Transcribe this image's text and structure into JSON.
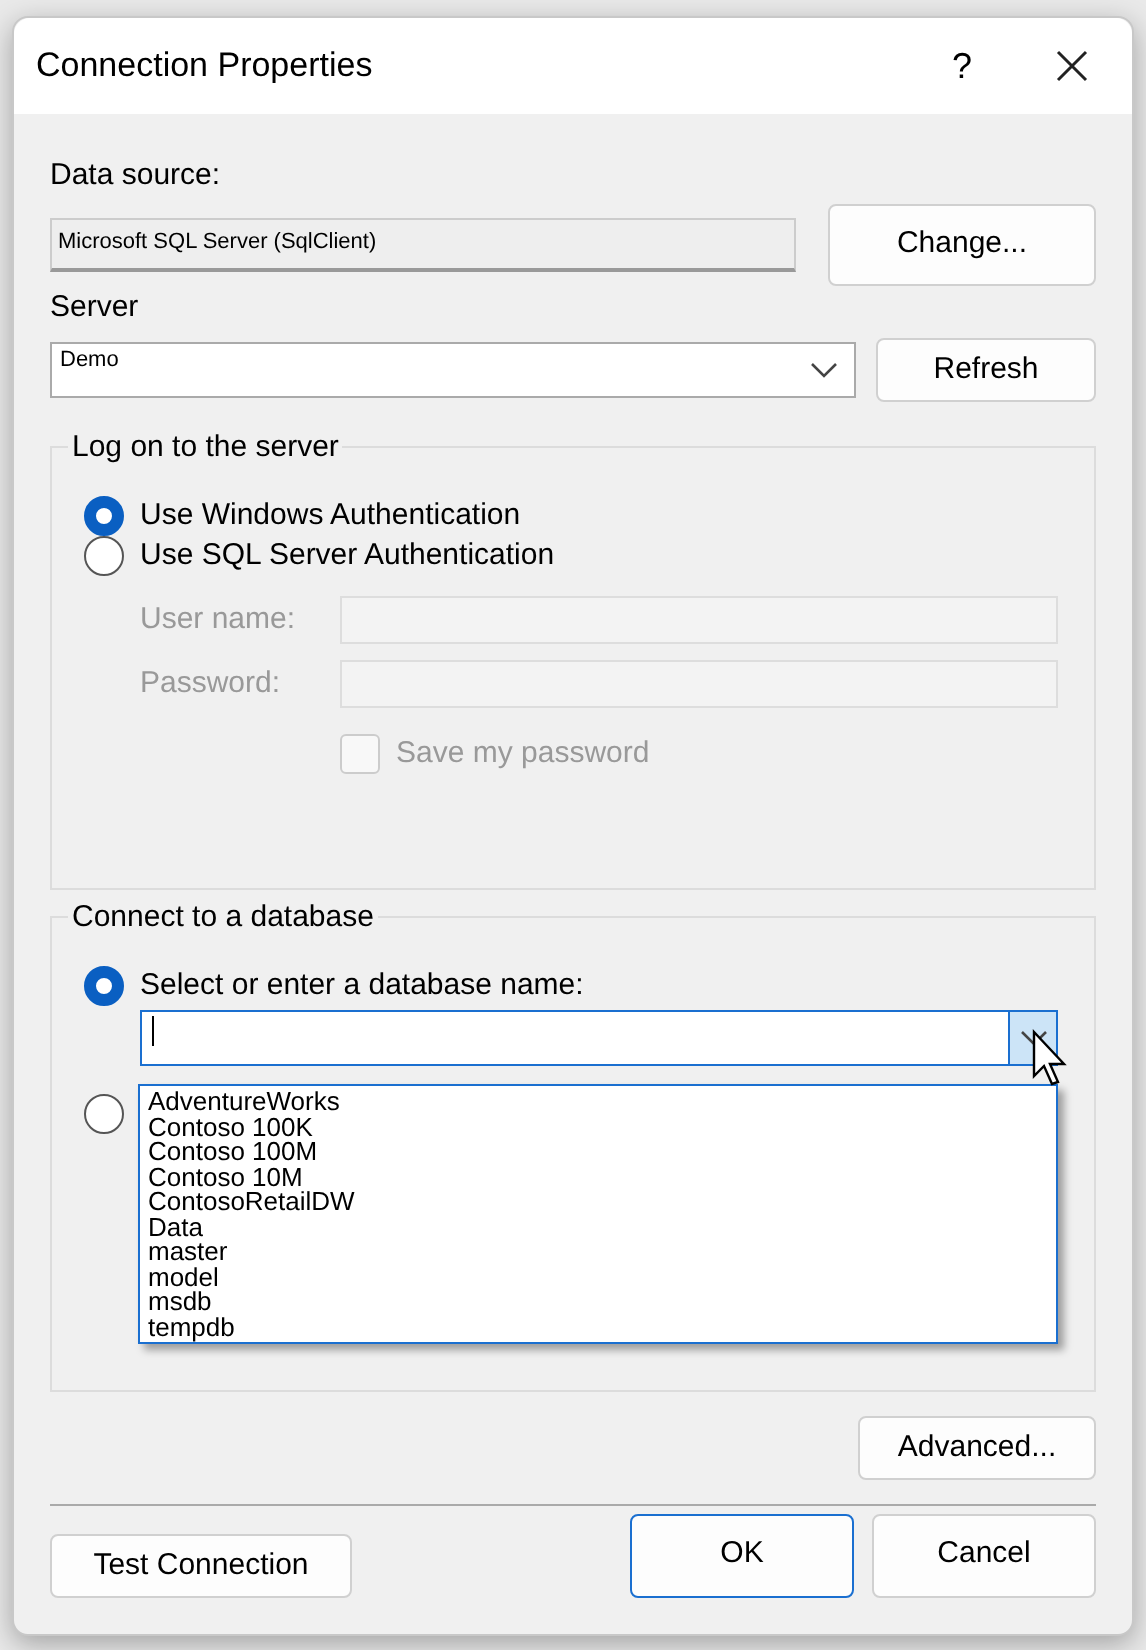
{
  "window": {
    "title": "Connection Properties",
    "help": "?"
  },
  "data_source": {
    "label": "Data source:",
    "value": "Microsoft SQL Server (SqlClient)",
    "button": "Change..."
  },
  "server": {
    "label": "Server",
    "value": "Demo",
    "button": "Refresh"
  },
  "log_on": {
    "legend": "Log on to the server",
    "options": [
      {
        "label": "Use Windows Authentication",
        "selected": true
      },
      {
        "label": "Use SQL Server Authentication",
        "selected": false
      }
    ],
    "fields": [
      {
        "label": "User name:",
        "disabled": true
      },
      {
        "label": "Password:",
        "disabled": true
      }
    ],
    "save_password": {
      "label": "Save my password",
      "checked": false,
      "disabled": true
    }
  },
  "database": {
    "legend": "Connect to a database",
    "options": [
      {
        "label": "Select or enter a database name:",
        "selected": true
      },
      {
        "selected": false
      }
    ],
    "dropdown": {
      "expanded": true,
      "items": [
        "AdventureWorks",
        "Contoso 100K",
        "Contoso 100M",
        "Contoso 10M",
        "ContosoRetailDW",
        "Data",
        "master",
        "model",
        "msdb",
        "tempdb"
      ]
    }
  },
  "advanced_button": "Advanced...",
  "footer": [
    {
      "label": "Test Connection",
      "default": false
    },
    {
      "label": "OK",
      "default": true
    },
    {
      "label": "Cancel",
      "default": false
    }
  ]
}
